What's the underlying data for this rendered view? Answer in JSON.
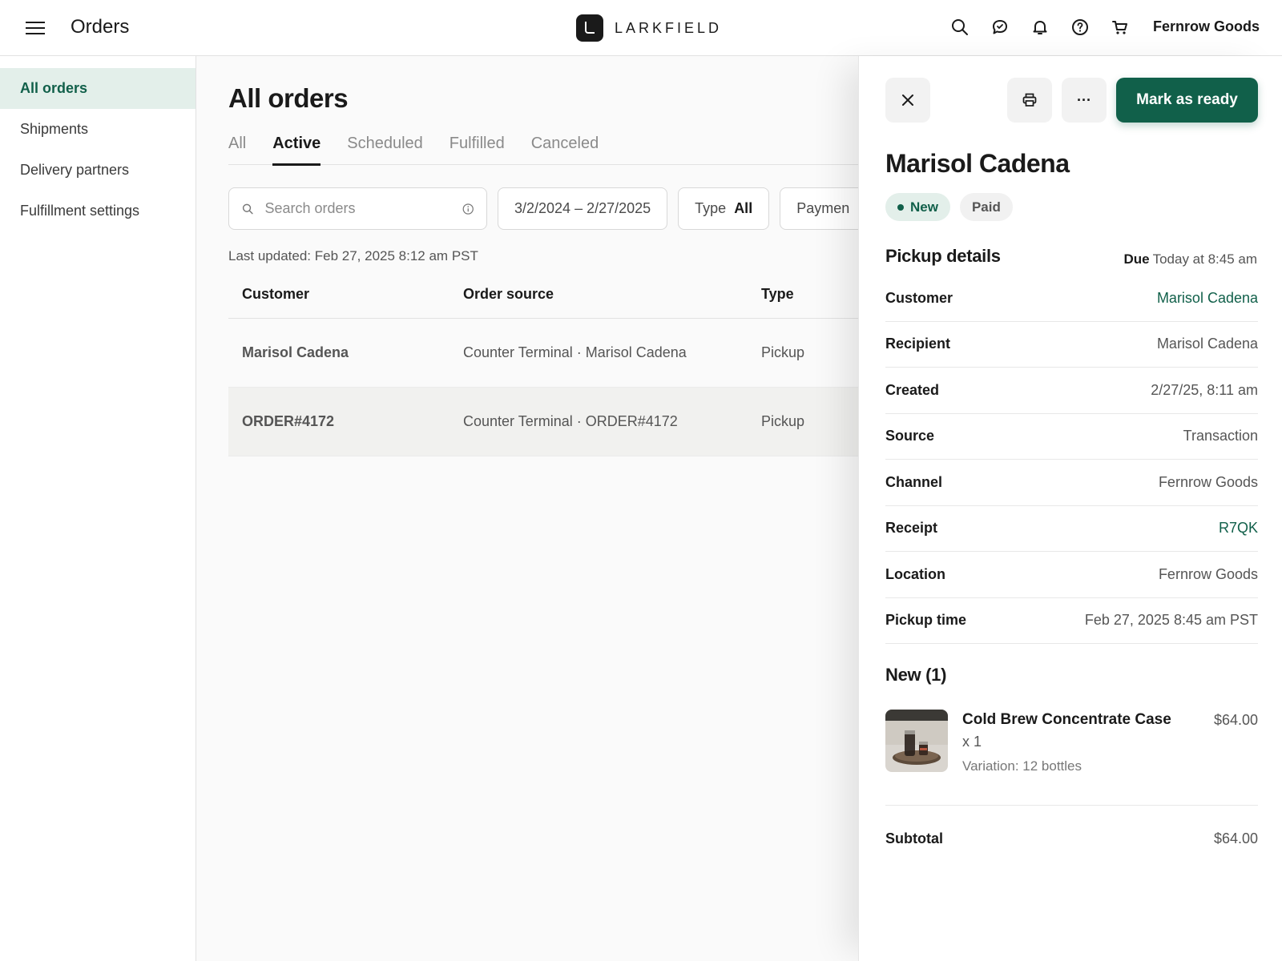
{
  "header": {
    "app_title": "Orders",
    "brand_name": "LARKFIELD",
    "merchant_name": "Fernrow Goods",
    "icons": [
      "search-icon",
      "chat-icon",
      "bell-icon",
      "help-icon",
      "cart-icon"
    ]
  },
  "sidebar": {
    "items": [
      {
        "label": "All orders",
        "active": true
      },
      {
        "label": "Shipments",
        "active": false
      },
      {
        "label": "Delivery partners",
        "active": false
      },
      {
        "label": "Fulfillment settings",
        "active": false
      }
    ]
  },
  "main": {
    "title": "All orders",
    "tabs": [
      "All",
      "Active",
      "Scheduled",
      "Fulfilled",
      "Canceled"
    ],
    "active_tab": "Active",
    "search": {
      "placeholder": "Search orders",
      "value": ""
    },
    "date_range": "3/2/2024 – 2/27/2025",
    "type_filter": {
      "label": "Type",
      "value": "All"
    },
    "payment_filter": {
      "label": "Paymen"
    },
    "last_updated": "Last updated: Feb 27, 2025 8:12 am PST",
    "table": {
      "columns": [
        "Customer",
        "Order source",
        "Type"
      ],
      "rows": [
        {
          "customer": "Marisol Cadena",
          "source": "Counter Terminal · Marisol Cadena",
          "type": "Pickup",
          "selected": false
        },
        {
          "customer": "ORDER#4172",
          "source": "Counter Terminal · ORDER#4172",
          "type": "Pickup",
          "selected": true
        }
      ]
    }
  },
  "panel": {
    "mark_ready_label": "Mark as ready",
    "more_label": "···",
    "customer_name": "Marisol Cadena",
    "badges": {
      "status": "New",
      "payment": "Paid"
    },
    "pickup_title": "Pickup details",
    "due_label": "Due",
    "due_value": "Today at 8:45 am",
    "details": [
      {
        "label": "Customer",
        "value": "Marisol Cadena",
        "link": true
      },
      {
        "label": "Recipient",
        "value": "Marisol Cadena",
        "link": false
      },
      {
        "label": "Created",
        "value": "2/27/25, 8:11 am",
        "link": false
      },
      {
        "label": "Source",
        "value": "Transaction",
        "link": false
      },
      {
        "label": "Channel",
        "value": "Fernrow Goods",
        "link": false
      },
      {
        "label": "Receipt",
        "value": "R7QK",
        "link": true
      },
      {
        "label": "Location",
        "value": "Fernrow Goods",
        "link": false
      },
      {
        "label": "Pickup time",
        "value": "Feb 27, 2025 8:45 am PST",
        "link": false
      }
    ],
    "items_title": "New (1)",
    "item": {
      "name": "Cold Brew Concentrate Case",
      "qty": "x 1",
      "variation": "Variation: 12 bottles",
      "price": "$64.00"
    },
    "subtotal_label": "Subtotal",
    "subtotal_value": "$64.00"
  },
  "colors": {
    "accent": "#11604a",
    "accent_soft": "#e3efea"
  }
}
